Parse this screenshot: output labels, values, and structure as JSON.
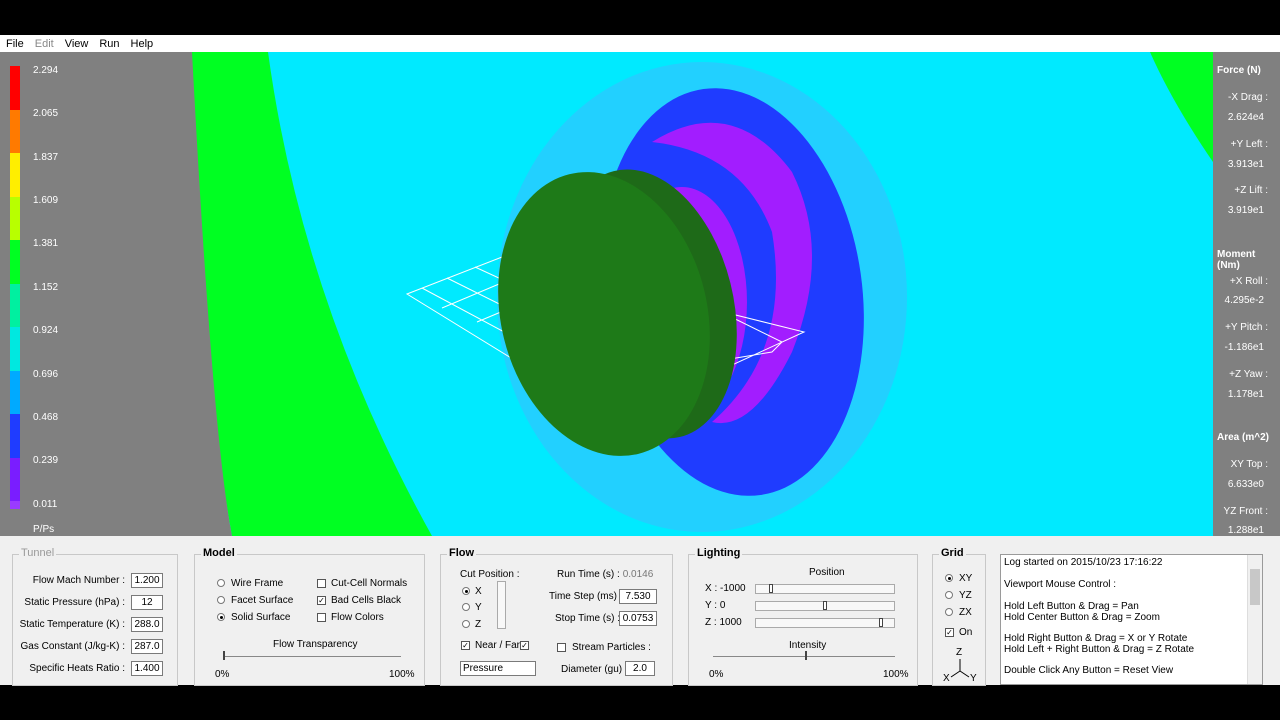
{
  "menu": [
    "File",
    "Edit",
    "View",
    "Run",
    "Help"
  ],
  "legend": {
    "values": [
      "2.294",
      "2.065",
      "1.837",
      "1.609",
      "1.381",
      "1.152",
      "0.924",
      "0.696",
      "0.468",
      "0.239",
      "0.011"
    ],
    "colors": [
      "#ff0000",
      "#ff7a00",
      "#ffee00",
      "#b8ff00",
      "#00ff22",
      "#00f0a0",
      "#00e8e0",
      "#00aaff",
      "#1f3cff",
      "#7a1dff",
      "#9a3bff"
    ],
    "unit": "P/Ps"
  },
  "force": {
    "title": "Force (N)",
    "drag_label": "-X Drag :",
    "drag": "2.624e4",
    "left_label": "+Y Left :",
    "left": "3.913e1",
    "lift_label": "+Z Lift :",
    "lift": "3.919e1"
  },
  "moment": {
    "title": "Moment (Nm)",
    "roll_label": "+X Roll :",
    "roll": "4.295e-2",
    "pitch_label": "+Y Pitch :",
    "pitch": "-1.186e1",
    "yaw_label": "+Z Yaw :",
    "yaw": "1.178e1"
  },
  "area": {
    "title": "Area (m^2)",
    "top_label": "XY Top :",
    "top": "6.633e0",
    "front_label": "YZ Front :",
    "front": "1.288e1"
  },
  "tunnel": {
    "title": "Tunnel",
    "mach_label": "Flow Mach Number :",
    "mach": "1.200",
    "pressure_label": "Static Pressure (hPa) :",
    "pressure": "12",
    "temp_label": "Static Temperature (K) :",
    "temp": "288.0",
    "gas_label": "Gas Constant (J/kg-K) :",
    "gas": "287.0",
    "ratio_label": "Specific Heats Ratio :",
    "ratio": "1.400"
  },
  "model": {
    "title": "Model",
    "wire": "Wire Frame",
    "facet": "Facet Surface",
    "solid": "Solid Surface",
    "normals": "Cut-Cell Normals",
    "badcells": "Bad Cells Black",
    "flowcolors": "Flow Colors",
    "transparency": "Flow Transparency",
    "min": "0%",
    "max": "100%"
  },
  "flow": {
    "title": "Flow",
    "cutpos": "Cut Position :",
    "x": "X",
    "y": "Y",
    "z": "Z",
    "runtime_label": "Run Time (s) :",
    "runtime": "0.0146",
    "timestep_label": "Time Step (ms) :",
    "timestep": "7.530",
    "stoptime_label": "Stop Time (s) :",
    "stoptime": "0.0753",
    "nearfar": "Near / Far",
    "stream": "Stream Particles :",
    "diameter_label": "Diameter (gu) :",
    "diameter": "2.0",
    "variable": "Pressure"
  },
  "lighting": {
    "title": "Lighting",
    "position": "Position",
    "x_label": "X : -1000",
    "y_label": "Y : 0",
    "z_label": "Z : 1000",
    "intensity": "Intensity",
    "min": "0%",
    "max": "100%"
  },
  "grid": {
    "title": "Grid",
    "xy": "XY",
    "yz": "YZ",
    "zx": "ZX",
    "on": "On",
    "ax_z": "Z",
    "ax_x": "X",
    "ax_y": "Y"
  },
  "log": [
    "Log started on 2015/10/23 17:16:22",
    "Viewport Mouse Control :",
    "Hold Left Button & Drag  =  Pan",
    "Hold Center Button & Drag  =  Zoom",
    "Hold Right Button & Drag  =  X or Y Rotate",
    "Hold Left + Right Button & Drag  =  Z Rotate",
    "Double Click Any Button  =  Reset View"
  ]
}
